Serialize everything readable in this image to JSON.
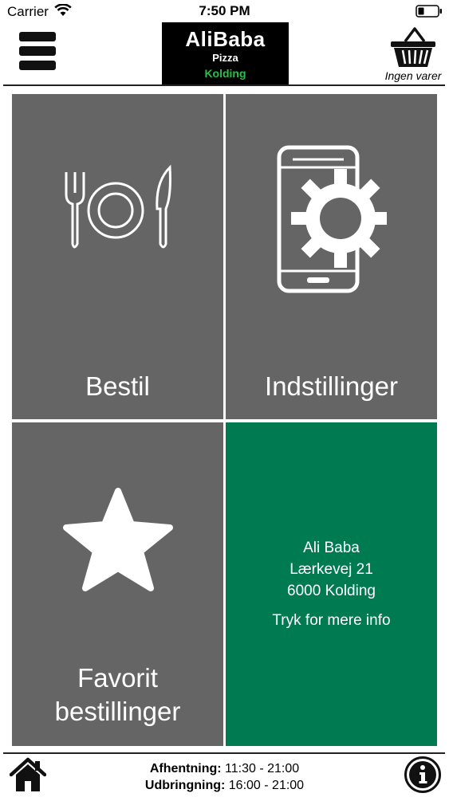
{
  "status_bar": {
    "carrier": "Carrier",
    "time": "7:50 PM"
  },
  "header": {
    "logo": {
      "title": "AliBaba",
      "subtitle": "Pizza",
      "city": "Kolding"
    },
    "basket_label": "Ingen varer"
  },
  "tiles": {
    "order_label": "Bestil",
    "settings_label": "Indstillinger",
    "favorites_label_line1": "Favorit",
    "favorites_label_line2": "bestillinger",
    "shop": {
      "name": "Ali Baba",
      "street": "Lærkevej 21",
      "city": "6000 Kolding",
      "more_info": "Tryk for mere info"
    }
  },
  "footer": {
    "pickup_label": "Afhentning:",
    "pickup_hours": "11:30 - 21:00",
    "delivery_label": "Udbringning:",
    "delivery_hours": "16:00 - 21:00"
  },
  "colors": {
    "tile_gray": "#656565",
    "info_green": "#007a50",
    "logo_city_green": "#28c04a"
  },
  "icons": {
    "menu": "hamburger-icon",
    "basket": "basket-icon",
    "order": "cutlery-plate-icon",
    "settings": "phone-gear-icon",
    "favorites": "star-icon",
    "home": "home-icon",
    "info": "info-icon"
  }
}
